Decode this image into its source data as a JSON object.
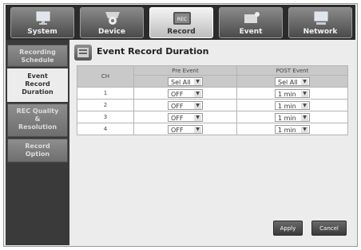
{
  "tabs": [
    {
      "label": "System",
      "icon": "monitor-icon"
    },
    {
      "label": "Device",
      "icon": "camera-icon"
    },
    {
      "label": "Record",
      "icon": "rec-icon",
      "icon_text": "REC"
    },
    {
      "label": "Event",
      "icon": "event-icon"
    },
    {
      "label": "Network",
      "icon": "network-icon"
    }
  ],
  "active_tab": "Record",
  "sidebar": {
    "items": [
      {
        "line1": "Recording",
        "line2": "Schedule",
        "line3": ""
      },
      {
        "line1": "Event",
        "line2": "Record",
        "line3": "Duration"
      },
      {
        "line1": "REC Quality",
        "line2": "&",
        "line3": "Resolution"
      },
      {
        "line1": "Record",
        "line2": "Option",
        "line3": ""
      }
    ],
    "active_item": "Event Record Duration"
  },
  "page": {
    "title": "Event Record Duration",
    "title_icon": "record-duration-icon"
  },
  "table": {
    "col_ch": "CH",
    "col_pre": "Pre Event",
    "col_post": "POST Event",
    "pre_select_all": "Sel All",
    "post_select_all": "Sel All",
    "rows": [
      {
        "ch": "1",
        "pre": "OFF",
        "post": "1 min"
      },
      {
        "ch": "2",
        "pre": "OFF",
        "post": "1 min"
      },
      {
        "ch": "3",
        "pre": "OFF",
        "post": "1 min"
      },
      {
        "ch": "4",
        "pre": "OFF",
        "post": "1 min"
      }
    ]
  },
  "buttons": {
    "apply": "Apply",
    "cancel": "Cancel"
  },
  "colors": {
    "active_tab": "#d9d9d9",
    "inactive_tab": "#6a6a6a",
    "sidebar_bg": "#3a3a3a",
    "content_bg": "#ececec"
  }
}
